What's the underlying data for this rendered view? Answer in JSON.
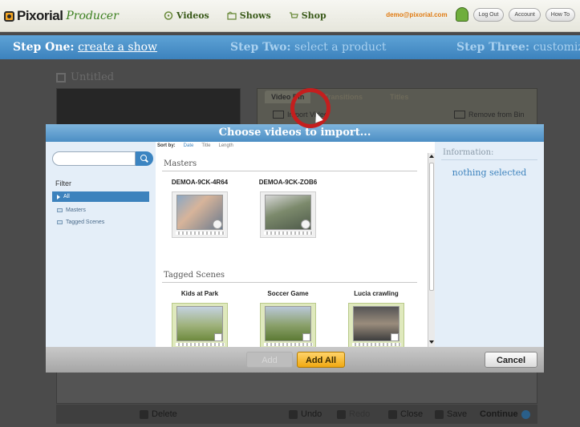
{
  "app": {
    "logo_text": "Pixorial",
    "logo_sub": "Producer"
  },
  "nav": {
    "items": [
      {
        "label": "Videos",
        "icon": "film-reel-icon"
      },
      {
        "label": "Shows",
        "icon": "folder-icon"
      },
      {
        "label": "Shop",
        "icon": "cart-icon"
      }
    ]
  },
  "user": {
    "email": "demo@pixorial.com",
    "logout_label": "Log Out",
    "account_label": "Account",
    "howto_label": "How To"
  },
  "steps": {
    "one_title": "Step One:",
    "one_sub": "create a show",
    "two_title": "Step Two:",
    "two_sub": "select a product",
    "three_title": "Step Three:",
    "three_sub": "customize"
  },
  "project": {
    "title": "Untitled"
  },
  "bin": {
    "tabs": [
      "Video Bin",
      "Transitions",
      "Titles"
    ],
    "import_label": "Import Video",
    "remove_label": "Remove from Bin"
  },
  "toolbar": {
    "delete": "Delete",
    "undo": "Undo",
    "redo": "Redo",
    "close": "Close",
    "save": "Save",
    "continue": "Continue"
  },
  "modal": {
    "title": "Choose videos to import...",
    "search_placeholder": "",
    "filter_label": "Filter",
    "filters": [
      "All",
      "Masters",
      "Tagged Scenes"
    ],
    "sort_label": "Sort by:",
    "sort_options": [
      "Date",
      "Title",
      "Length"
    ],
    "masters_title": "Masters",
    "masters": [
      {
        "name": "DEMOA-9CK-4R64"
      },
      {
        "name": "DEMOA-9CK-ZOB6"
      }
    ],
    "tagged_title": "Tagged Scenes",
    "tagged": [
      {
        "name": "Kids at Park"
      },
      {
        "name": "Soccer Game"
      },
      {
        "name": "Lucia crawling"
      }
    ],
    "info_title": "Information:",
    "info_value": "nothing selected",
    "add_label": "Add",
    "add_all_label": "Add All",
    "cancel_label": "Cancel"
  },
  "colors": {
    "accent_blue": "#3c82bd",
    "highlight_red": "#c41e1e",
    "add_all_orange": "#f0a912"
  }
}
